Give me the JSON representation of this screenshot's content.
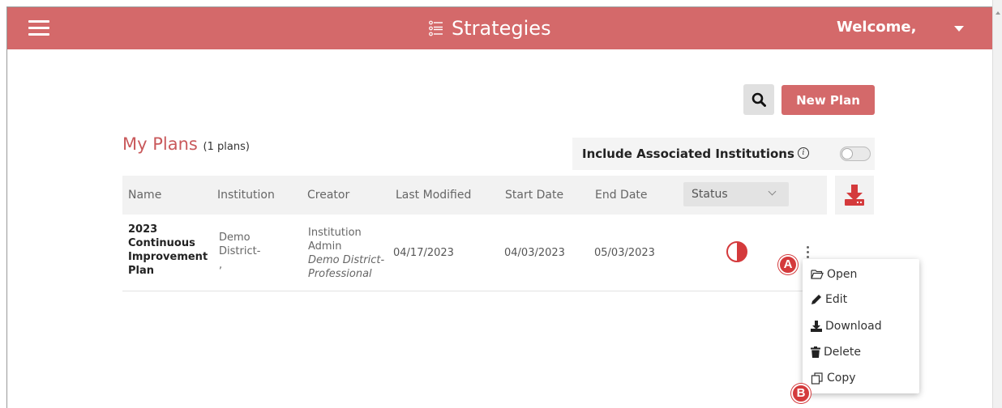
{
  "header": {
    "title": "Strategies",
    "welcome": "Welcome,"
  },
  "toolbar": {
    "new_plan_label": "New Plan"
  },
  "section": {
    "title": "My Plans",
    "count": "(1 plans)"
  },
  "include_associated": {
    "label": "Include Associated Institutions",
    "enabled": false
  },
  "table": {
    "columns": [
      "Name",
      "Institution",
      "Creator",
      "Last Modified",
      "Start Date",
      "End Date"
    ],
    "status_filter": "Status",
    "rows": [
      {
        "name": "2023 Continuous Improvement Plan",
        "institution_line1": "Demo",
        "institution_line2": "District-",
        "institution_line3": ",",
        "creator_line1": "Institution",
        "creator_line2": "Admin",
        "creator_org_line1": "Demo District-",
        "creator_org_line2": "Professional",
        "last_modified": "04/17/2023",
        "start_date": "04/03/2023",
        "end_date": "05/03/2023",
        "status_progress": 0.5
      }
    ]
  },
  "action_menu": {
    "items": [
      {
        "label": "Open",
        "icon": "folder-open-icon"
      },
      {
        "label": "Edit",
        "icon": "pencil-icon"
      },
      {
        "label": "Download",
        "icon": "download-icon"
      },
      {
        "label": "Delete",
        "icon": "trash-icon"
      },
      {
        "label": "Copy",
        "icon": "copy-icon"
      }
    ]
  },
  "callouts": {
    "a": "A",
    "b": "B"
  },
  "colors": {
    "brand": "#d4696a",
    "section_title": "#c9595b",
    "badge": "#d43a3c"
  }
}
